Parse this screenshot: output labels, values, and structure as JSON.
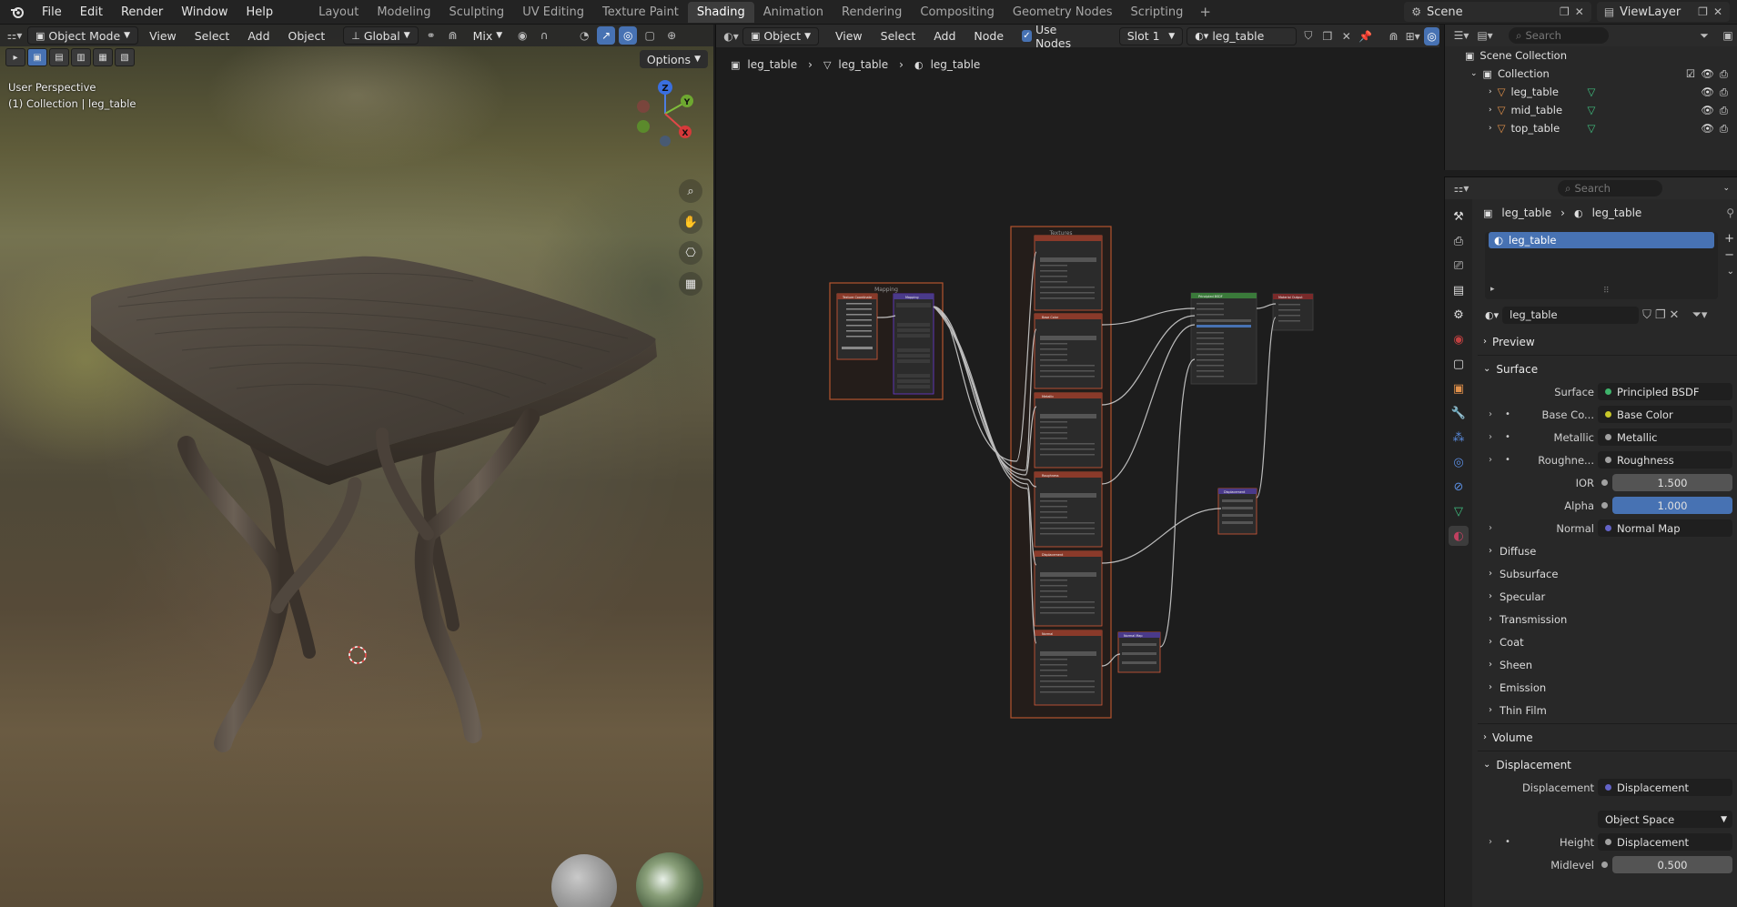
{
  "topbar": {
    "menus": [
      "File",
      "Edit",
      "Render",
      "Window",
      "Help"
    ],
    "workspaces": [
      "Layout",
      "Modeling",
      "Sculpting",
      "UV Editing",
      "Texture Paint",
      "Shading",
      "Animation",
      "Rendering",
      "Compositing",
      "Geometry Nodes",
      "Scripting"
    ],
    "active_workspace": "Shading",
    "add_tab": "+",
    "scene": "Scene",
    "view_layer": "ViewLayer"
  },
  "viewport": {
    "mode": "Object Mode",
    "menus": [
      "View",
      "Select",
      "Add",
      "Object"
    ],
    "orientation": "Global",
    "snap_blend": "Mix",
    "options": "Options",
    "perspective": "User Perspective",
    "collection_info": "(1) Collection | leg_table",
    "gizmo": {
      "z": "Z",
      "y": "Y",
      "x": "X"
    }
  },
  "node_editor": {
    "type": "Object",
    "menus": [
      "View",
      "Select",
      "Add",
      "Node"
    ],
    "use_nodes_label": "Use Nodes",
    "slot": "Slot 1",
    "material": "leg_table",
    "breadcrumb": [
      "leg_table",
      "leg_table",
      "leg_table"
    ],
    "frames": {
      "mapping": "Mapping",
      "textures": "Textures"
    },
    "nodes": {
      "tex_coord": "Texture Coordinate",
      "mapping": "Mapping",
      "base_color": "Base Color",
      "metallic": "Metallic",
      "roughness": "Roughness",
      "displacement": "Displacement",
      "normal": "Normal",
      "principled": "Principled BSDF",
      "output": "Material Output",
      "disp_node": "Displacement",
      "normal_map": "Normal Map"
    }
  },
  "outliner": {
    "search_placeholder": "Search",
    "root": "Scene Collection",
    "collection": "Collection",
    "objects": [
      "leg_table",
      "mid_table",
      "top_table"
    ]
  },
  "properties": {
    "search_placeholder": "Search",
    "breadcrumb_object": "leg_table",
    "breadcrumb_material": "leg_table",
    "slot_item": "leg_table",
    "material_name": "leg_table",
    "panels": {
      "preview": "Preview",
      "surface": "Surface",
      "volume": "Volume",
      "displacement": "Displacement"
    },
    "surface_rows": [
      {
        "label": "Surface",
        "value": "Principled BSDF",
        "color": "#3fb36b"
      },
      {
        "label": "Base Co...",
        "value": "Base Color",
        "color": "#c7c729"
      },
      {
        "label": "Metallic",
        "value": "Metallic",
        "color": "#a1a1a1"
      },
      {
        "label": "Roughne...",
        "value": "Roughness",
        "color": "#a1a1a1"
      },
      {
        "label": "IOR",
        "value": "1.500",
        "color": "#a1a1a1"
      },
      {
        "label": "Alpha",
        "value": "1.000",
        "color": "#a1a1a1"
      },
      {
        "label": "Normal",
        "value": "Normal Map",
        "color": "#6363c7"
      }
    ],
    "subpanels": [
      "Diffuse",
      "Subsurface",
      "Specular",
      "Transmission",
      "Coat",
      "Sheen",
      "Emission",
      "Thin Film"
    ],
    "disp_rows": [
      {
        "label": "Displacement",
        "value": "Displacement",
        "color": "#6363c7"
      },
      {
        "label": "",
        "value": "Object Space"
      },
      {
        "label": "Height",
        "value": "Displacement",
        "color": "#a1a1a1"
      },
      {
        "label": "Midlevel",
        "value": "0.500"
      }
    ]
  }
}
